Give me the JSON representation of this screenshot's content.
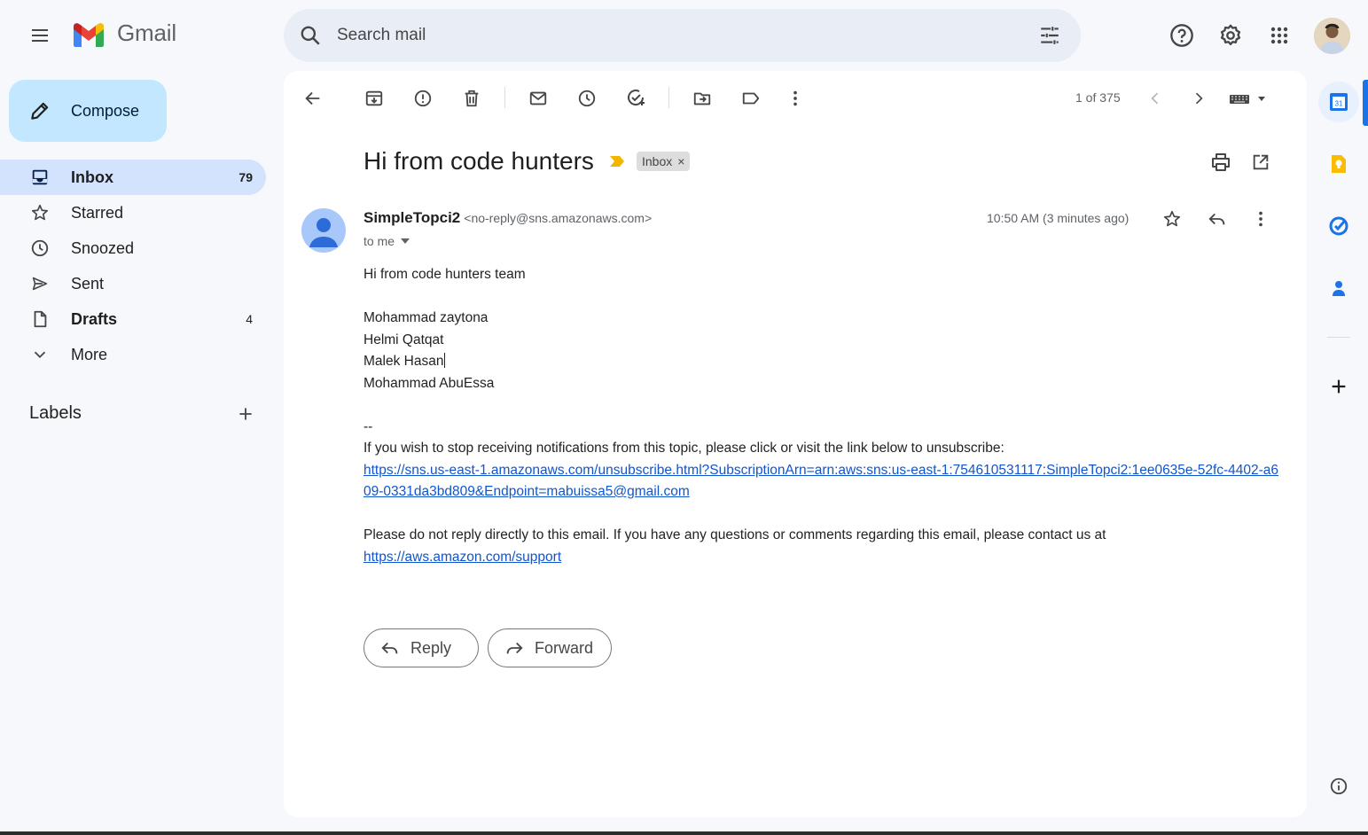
{
  "app": {
    "name": "Gmail"
  },
  "search": {
    "placeholder": "Search mail"
  },
  "compose": {
    "label": "Compose"
  },
  "nav": {
    "items": [
      {
        "label": "Inbox",
        "count": "79",
        "icon": "inbox-icon"
      },
      {
        "label": "Starred",
        "count": "",
        "icon": "star-icon"
      },
      {
        "label": "Snoozed",
        "count": "",
        "icon": "clock-icon"
      },
      {
        "label": "Sent",
        "count": "",
        "icon": "send-icon"
      },
      {
        "label": "Drafts",
        "count": "4",
        "icon": "draft-icon"
      },
      {
        "label": "More",
        "count": "",
        "icon": "chevron-down-icon"
      }
    ]
  },
  "labels": {
    "heading": "Labels"
  },
  "toolbar": {
    "pager": "1 of 375"
  },
  "email": {
    "subject": "Hi from code hunters",
    "label_chip": "Inbox",
    "sender_name": "SimpleTopci2",
    "sender_email": "<no-reply@sns.amazonaws.com>",
    "to": "to me",
    "time": "10:50 AM (3 minutes ago)",
    "body": {
      "greeting": "Hi from code hunters team",
      "names": [
        "Mohammad zaytona",
        "Helmi Qatqat",
        "Malek Hasan",
        "Mohammad AbuEssa"
      ],
      "sig_sep": "--",
      "unsubscribe_text": "If you wish to stop receiving notifications from this topic, please click or visit the link below to unsubscribe:",
      "unsubscribe_link": "https://sns.us-east-1.amazonaws.com/unsubscribe.html?SubscriptionArn=arn:aws:sns:us-east-1:754610531117:SimpleTopci2:1ee0635e-52fc-4402-a609-0331da3bd809&Endpoint=mabuissa5@gmail.com",
      "contact_text": "Please do not reply directly to this email. If you have any questions or comments regarding this email, please contact us at",
      "contact_link": "https://aws.amazon.com/support"
    }
  },
  "actions": {
    "reply": "Reply",
    "forward": "Forward"
  },
  "side_panel": {
    "calendar_day": "31"
  },
  "colors": {
    "accent": "#0b57d0",
    "compose_bg": "#c2e7ff",
    "active_nav": "#d3e3fd",
    "link": "#1155cc",
    "important": "#f2b600"
  }
}
